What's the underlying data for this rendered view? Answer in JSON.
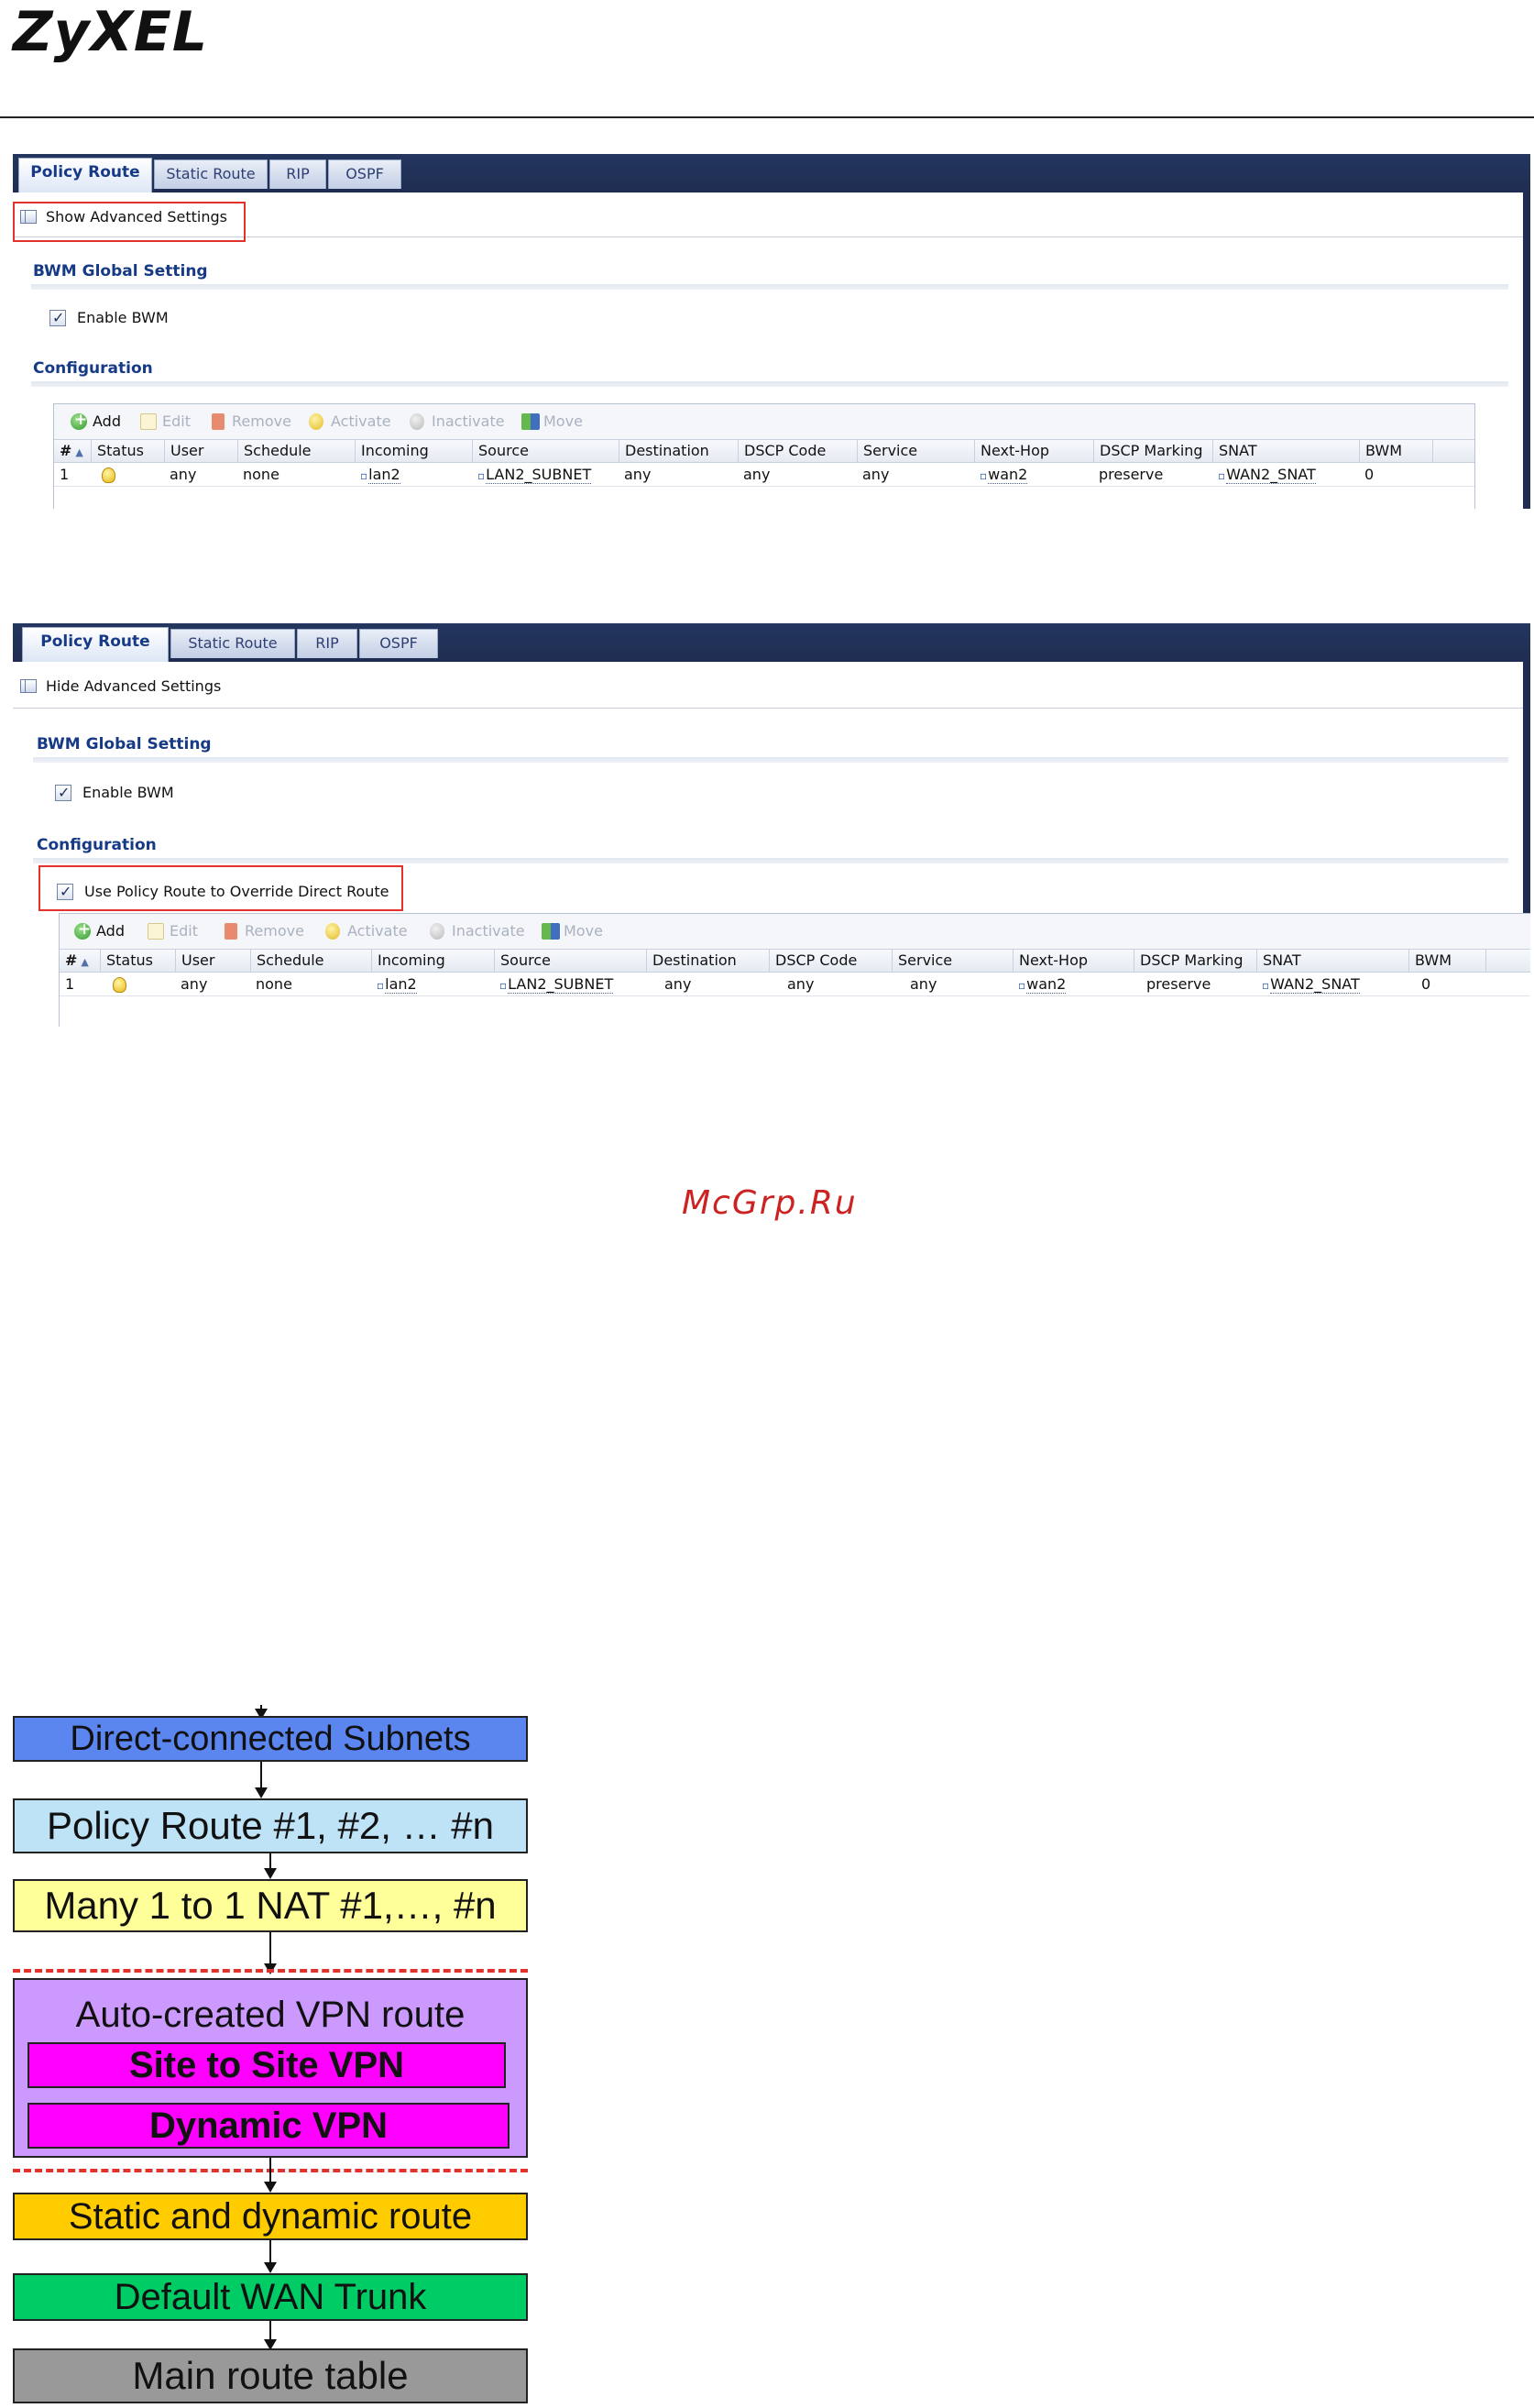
{
  "logo": {
    "text": "ZyXEL"
  },
  "panel1": {
    "tabs": [
      "Policy Route",
      "Static Route",
      "RIP",
      "OSPF"
    ],
    "advanced_link": "Show Advanced Settings",
    "bwm_title": "BWM Global Setting",
    "bwm_checkbox": "Enable BWM",
    "config_title": "Configuration"
  },
  "panel2": {
    "tabs": [
      "Policy Route",
      "Static Route",
      "RIP",
      "OSPF"
    ],
    "advanced_link": "Hide Advanced Settings",
    "bwm_title": "BWM Global Setting",
    "bwm_checkbox": "Enable BWM",
    "config_title": "Configuration",
    "override_checkbox": "Use Policy Route to Override Direct Route"
  },
  "toolbar": [
    "Add",
    "Edit",
    "Remove",
    "Activate",
    "Inactivate",
    "Move"
  ],
  "columns": [
    "#",
    "Status",
    "User",
    "Schedule",
    "Incoming",
    "Source",
    "Destination",
    "DSCP Code",
    "Service",
    "Next-Hop",
    "DSCP Marking",
    "SNAT",
    "BWM"
  ],
  "row": {
    "num": "1",
    "status": "bulb-on-icon",
    "user": "any",
    "schedule": "none",
    "incoming": "lan2",
    "source": "LAN2_SUBNET",
    "destination": "any",
    "dscp_code": "any",
    "service": "any",
    "next_hop": "wan2",
    "dscp_marking": "preserve",
    "snat": "WAN2_SNAT",
    "bwm": "0"
  },
  "watermark": "McGrp.Ru",
  "flow": {
    "direct": "Direct-connected Subnets",
    "policy": "Policy Route #1, #2, … #n",
    "nat": "Many 1 to 1 NAT #1,…, #n",
    "vpn": "Auto-created VPN route",
    "site_vpn": "Site to Site VPN",
    "dynamic_vpn": "Dynamic VPN",
    "static": "Static and dynamic route",
    "wan": "Default WAN Trunk",
    "main": "Main route table"
  },
  "colors": {
    "tab_bar": "#1f2d51",
    "section_title": "#173a86",
    "highlight_box": "#e2322d",
    "flow_direct": "#5b86f0",
    "flow_policy": "#bfe3f6",
    "flow_nat": "#ffff99",
    "flow_vpn": "#cc99ff",
    "flow_site": "#ff00ff",
    "flow_static": "#ffcc00",
    "flow_wan": "#00cc66",
    "flow_main": "#999999"
  }
}
